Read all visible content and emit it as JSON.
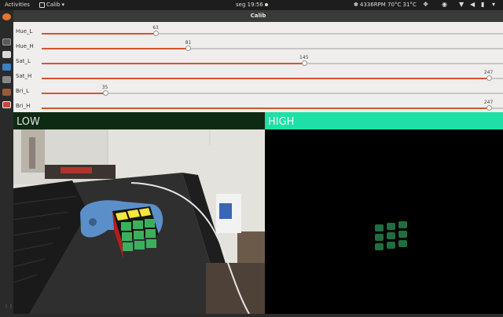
{
  "topbar": {
    "activities": "Activities",
    "app_name": "Calib",
    "clock": "seg 19:56",
    "system_status": "4336RPM 70°C 31°C"
  },
  "window": {
    "title": "Calib"
  },
  "trackbars": {
    "max": 255,
    "items": [
      {
        "label": "Hue_L",
        "value": 63
      },
      {
        "label": "Hue_H",
        "value": 81
      },
      {
        "label": "Sat_L",
        "value": 145
      },
      {
        "label": "Sat_H",
        "value": 247
      },
      {
        "label": "Bri_L",
        "value": 35
      },
      {
        "label": "Bri_H",
        "value": 247
      }
    ]
  },
  "panels": {
    "low_label": "LOW",
    "high_label": "HIGH"
  },
  "colors": {
    "slider_fill": "#d4562c",
    "low_header": "#0f2a12",
    "high_header": "#1ee0a6",
    "mask_blob": "#1f6e3f"
  },
  "icons": {
    "dock": [
      "firefox-icon",
      "files-icon",
      "text-editor-icon",
      "software-icon",
      "settings-icon",
      "terminal-icon",
      "calib-app-icon",
      "show-apps-icon"
    ],
    "tray": [
      "network-icon",
      "volume-icon",
      "battery-icon",
      "power-icon"
    ]
  }
}
